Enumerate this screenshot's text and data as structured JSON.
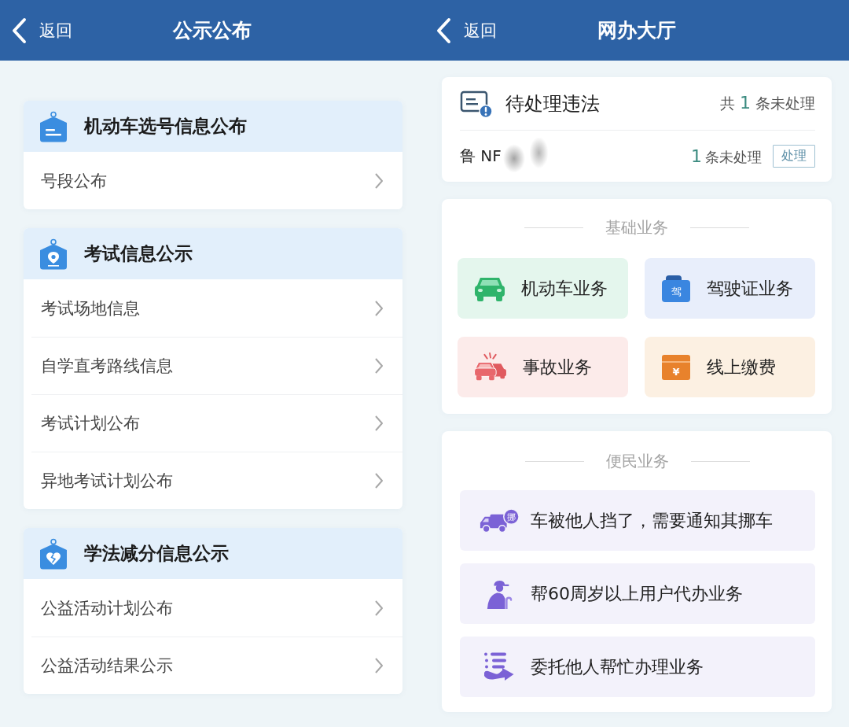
{
  "left_screen": {
    "header": {
      "back_label": "返回",
      "title": "公示公布"
    },
    "sections": [
      {
        "kind": "lines",
        "title": "机动车选号信息公布",
        "items": [
          "号段公布"
        ]
      },
      {
        "kind": "pin",
        "title": "考试信息公示",
        "items": [
          "考试场地信息",
          "自学直考路线信息",
          "考试计划公布",
          "异地考试计划公布"
        ]
      },
      {
        "kind": "heart",
        "title": "学法减分信息公示",
        "items": [
          "公益活动计划公布",
          "公益活动结果公示"
        ]
      }
    ]
  },
  "right_screen": {
    "header": {
      "back_label": "返回",
      "title": "网办大厅"
    },
    "violations": {
      "title": "待处理违法",
      "total": {
        "prefix": "共",
        "count": "1",
        "suffix": "条未处理"
      },
      "vehicles": [
        {
          "plate": "鲁 NF",
          "pending": {
            "count": "1",
            "suffix": "条未处理"
          },
          "action": "处理"
        }
      ]
    },
    "basic_services": {
      "title": "基础业务",
      "tiles": [
        {
          "kind": "car",
          "label": "机动车业务"
        },
        {
          "kind": "license",
          "label": "驾驶证业务",
          "icon_text": "驾"
        },
        {
          "kind": "accident",
          "label": "事故业务"
        },
        {
          "kind": "payment",
          "label": "线上缴费",
          "icon_text": "¥"
        }
      ]
    },
    "convenience_services": {
      "title": "便民业务",
      "rows": [
        {
          "kind": "move-car",
          "label": "车被他人挡了，需要通知其挪车",
          "icon_text": "挪"
        },
        {
          "kind": "elderly",
          "label": "帮60周岁以上用户代办业务"
        },
        {
          "kind": "delegate",
          "label": "委托他人帮忙办理业务"
        }
      ]
    }
  }
}
